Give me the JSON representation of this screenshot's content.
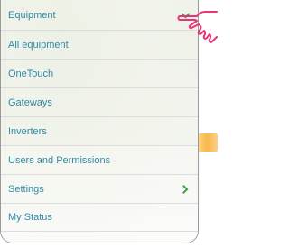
{
  "menu": {
    "items": [
      {
        "label": "Equipment",
        "icon": "chevron-down-icon"
      },
      {
        "label": "All equipment"
      },
      {
        "label": "OneTouch"
      },
      {
        "label": "Gateways"
      },
      {
        "label": "Inverters"
      },
      {
        "label": "Users and Permissions"
      },
      {
        "label": "Settings",
        "icon": "chevron-right-icon"
      },
      {
        "label": "My Status"
      }
    ]
  },
  "colors": {
    "item_text": "#2e8aa8",
    "chevron": "#43a047",
    "pointer_hand": "#e8357a",
    "panel_border": "#9a9a9a"
  },
  "pointer": {
    "icon": "pointing-hand-icon"
  }
}
